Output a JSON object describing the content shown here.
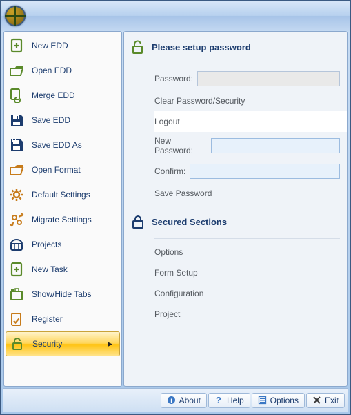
{
  "sidebar": {
    "items": [
      {
        "label": "New EDD",
        "icon": "file-plus-icon",
        "color": "#5a8a2a"
      },
      {
        "label": "Open EDD",
        "icon": "folder-open-icon",
        "color": "#5a8a2a"
      },
      {
        "label": "Merge EDD",
        "icon": "file-merge-icon",
        "color": "#5a8a2a"
      },
      {
        "label": "Save EDD",
        "icon": "save-icon",
        "color": "#1c3c6e"
      },
      {
        "label": "Save EDD As",
        "icon": "save-as-icon",
        "color": "#1c3c6e"
      },
      {
        "label": "Open Format",
        "icon": "folder-format-icon",
        "color": "#c77b1a"
      },
      {
        "label": "Default Settings",
        "icon": "gear-icon",
        "color": "#c77b1a"
      },
      {
        "label": "Migrate Settings",
        "icon": "migrate-icon",
        "color": "#c77b1a"
      },
      {
        "label": "Projects",
        "icon": "projects-icon",
        "color": "#1c3c6e"
      },
      {
        "label": "New Task",
        "icon": "file-plus-icon",
        "color": "#5a8a2a"
      },
      {
        "label": "Show/Hide Tabs",
        "icon": "tabs-icon",
        "color": "#5a8a2a"
      },
      {
        "label": "Register",
        "icon": "register-icon",
        "color": "#c77b1a"
      },
      {
        "label": "Security",
        "icon": "unlock-icon",
        "color": "#5a8a2a",
        "active": true,
        "submenu": true
      }
    ]
  },
  "security": {
    "head1": "Please setup password",
    "password_label": "Password:",
    "clear_label": "Clear Password/Security",
    "logout_label": "Logout",
    "newpass_label": "New Password:",
    "confirm_label": "Confirm:",
    "savepass_label": "Save Password",
    "head2": "Secured Sections",
    "sections": [
      "Options",
      "Form Setup",
      "Configuration",
      "Project"
    ]
  },
  "bottom": {
    "about": "About",
    "help": "Help",
    "options": "Options",
    "exit": "Exit"
  }
}
